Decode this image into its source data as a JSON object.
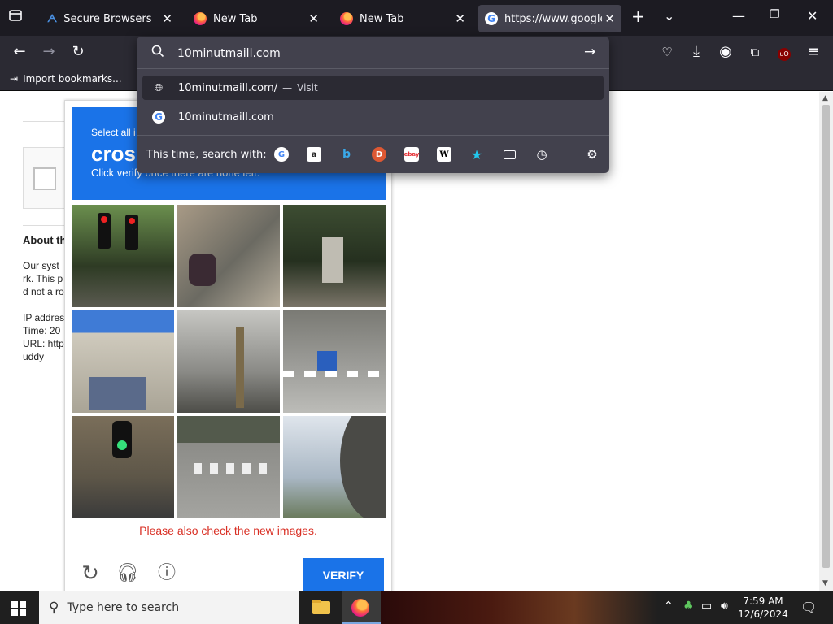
{
  "tabs": [
    {
      "title": "Secure Browsers",
      "active": false
    },
    {
      "title": "New Tab",
      "active": false
    },
    {
      "title": "New Tab",
      "active": false
    },
    {
      "title": "https://www.google.com",
      "active": true
    }
  ],
  "bookmarks": {
    "import_label": "Import bookmarks..."
  },
  "urlbar": {
    "value": "10minutmaill.com",
    "suggestions": [
      {
        "text": "10minutmaill.com/",
        "action": "Visit"
      },
      {
        "text": "10minutmaill.com",
        "action": ""
      }
    ],
    "search_with_label": "This time, search with:"
  },
  "left_page": {
    "heading": "About th",
    "lines": [
      "Our syst",
      "rk. This p",
      "d not a ro",
      "",
      "IP addres",
      "Time: 20",
      "URL: http",
      "uddy"
    ]
  },
  "captcha": {
    "select_text": "Select all i",
    "title": "cros",
    "subtitle": "Click verify once there are none left.",
    "message": "Please also check the new images.",
    "verify_label": "VERIFY"
  },
  "taskbar": {
    "search_placeholder": "Type here to search",
    "time": "7:59 AM",
    "date": "12/6/2024"
  },
  "colors": {
    "accent": "#1a73e8",
    "error": "#d93025",
    "toolbar": "#2b2a33"
  }
}
